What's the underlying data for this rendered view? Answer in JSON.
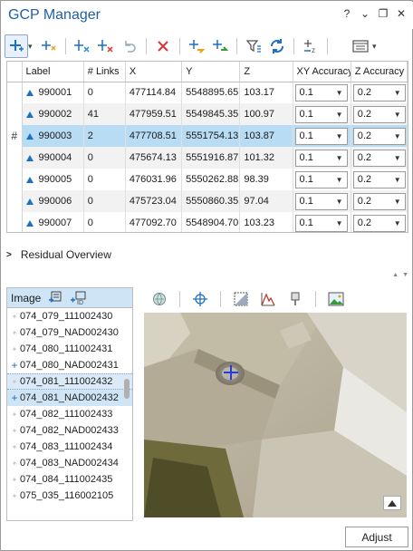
{
  "window": {
    "title": "GCP Manager",
    "help": "?",
    "menu": "⌄",
    "restore": "❐",
    "close": "✕"
  },
  "table": {
    "columns": [
      "Label",
      "# Links",
      "X",
      "Y",
      "Z",
      "XY Accuracy",
      "Z Accuracy"
    ],
    "selected_marker": "#",
    "rows": [
      {
        "label": "990001",
        "links": "0",
        "x": "477114.84",
        "y": "5548895.65",
        "z": "103.17",
        "xy": "0.1",
        "za": "0.2"
      },
      {
        "label": "990002",
        "links": "41",
        "x": "477959.51",
        "y": "5549845.35",
        "z": "100.97",
        "xy": "0.1",
        "za": "0.2"
      },
      {
        "label": "990003",
        "links": "2",
        "x": "477708.51",
        "y": "5551754.13",
        "z": "103.87",
        "xy": "0.1",
        "za": "0.2"
      },
      {
        "label": "990004",
        "links": "0",
        "x": "475674.13",
        "y": "5551916.87",
        "z": "101.32",
        "xy": "0.1",
        "za": "0.2"
      },
      {
        "label": "990005",
        "links": "0",
        "x": "476031.96",
        "y": "5550262.88",
        "z": "98.39",
        "xy": "0.1",
        "za": "0.2"
      },
      {
        "label": "990006",
        "links": "0",
        "x": "475723.04",
        "y": "5550860.35",
        "z": "97.04",
        "xy": "0.1",
        "za": "0.2"
      },
      {
        "label": "990007",
        "links": "0",
        "x": "477092.70",
        "y": "5548904.70",
        "z": "103.23",
        "xy": "0.1",
        "za": "0.2"
      }
    ]
  },
  "residual": {
    "label": "Residual Overview"
  },
  "images": {
    "header": "Image",
    "items": [
      {
        "name": "074_079_111002430",
        "mark": "star"
      },
      {
        "name": "074_079_NAD002430",
        "mark": "star"
      },
      {
        "name": "074_080_111002431",
        "mark": "star"
      },
      {
        "name": "074_080_NAD002431",
        "mark": "plus"
      },
      {
        "name": "074_081_111002432",
        "mark": "star"
      },
      {
        "name": "074_081_NAD002432",
        "mark": "plus"
      },
      {
        "name": "074_082_111002433",
        "mark": "star"
      },
      {
        "name": "074_082_NAD002433",
        "mark": "star"
      },
      {
        "name": "074_083_111002434",
        "mark": "star"
      },
      {
        "name": "074_083_NAD002434",
        "mark": "star"
      },
      {
        "name": "074_084_111002435",
        "mark": "star"
      },
      {
        "name": "075_035_116002105",
        "mark": "star"
      }
    ]
  },
  "buttons": {
    "adjust": "Adjust"
  }
}
